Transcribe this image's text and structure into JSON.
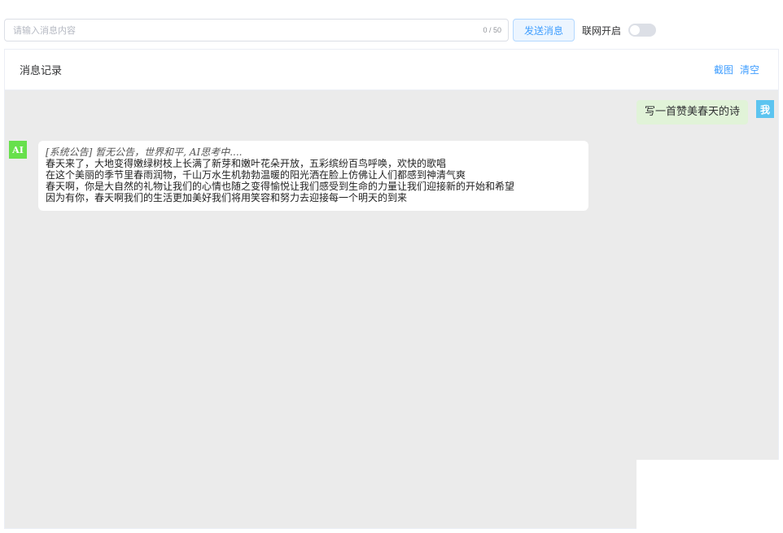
{
  "input": {
    "placeholder": "请输入消息内容",
    "value": "",
    "counter": "0 / 50"
  },
  "send_button_label": "发送消息",
  "network": {
    "label": "联网开启",
    "enabled": false
  },
  "panel": {
    "title": "消息记录",
    "actions": {
      "screenshot": "截图",
      "clear": "清空"
    }
  },
  "messages": {
    "user": {
      "avatar": "我",
      "text": "写一首赞美春天的诗"
    },
    "ai": {
      "avatar": "AI",
      "notice": "[系统公告] 暂无公告，世界和平, AI思考中....",
      "lines": [
        "春天来了，大地变得嫩绿树枝上长满了新芽和嫩叶花朵开放，五彩缤纷百鸟呼唤，欢快的歌唱",
        "在这个美丽的季节里春雨润物，千山万水生机勃勃温暖的阳光洒在脸上仿佛让人们都感到神清气爽",
        "春天啊，你是大自然的礼物让我们的心情也随之变得愉悦让我们感受到生命的力量让我们迎接新的开始和希望",
        "因为有你，春天啊我们的生活更加美好我们将用笑容和努力去迎接每一个明天的到来"
      ]
    }
  },
  "colors": {
    "accent": "#409eff",
    "user_bubble": "#e1f3d8",
    "user_avatar": "#5cc4f0",
    "ai_avatar": "#67e04c",
    "chat_background": "#ebebeb"
  }
}
